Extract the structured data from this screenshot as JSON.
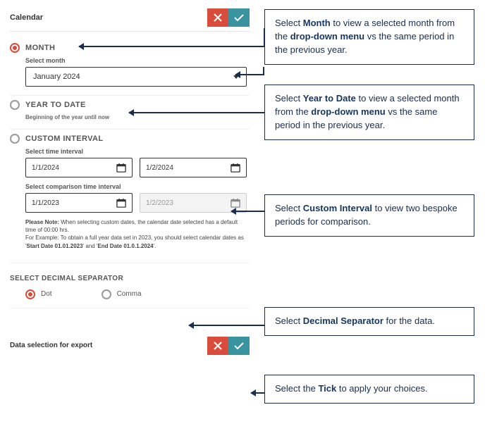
{
  "header": {
    "title": "Calendar"
  },
  "month": {
    "label": "MONTH",
    "selectLabel": "Select month",
    "value": "January 2024"
  },
  "ytd": {
    "label": "YEAR TO DATE",
    "note": "Beginning of the year until now"
  },
  "custom": {
    "label": "CUSTOM INTERVAL",
    "intervalLabel": "Select time interval",
    "start": "1/1/2024",
    "end": "1/2/2024",
    "compLabel": "Select comparison time interval",
    "compStart": "1/1/2023",
    "compEnd": "1/2/2023",
    "noteLead": "Please Note:",
    "noteBody": " When selecting custom dates, the calendar date selected has a default time of 00:00 hrs.",
    "noteEx1": "For Example: To obtain a full year data set in 2023, you should select calendar dates as '",
    "noteEx2": "Start Date 01.01.2023",
    "noteEx3": "' and '",
    "noteEx4": "End Date 01.0.1.2024",
    "noteEx5": "'."
  },
  "separator": {
    "title": "SELECT DECIMAL SEPARATOR",
    "dot": "Dot",
    "comma": "Comma"
  },
  "footer": {
    "title": "Data selection for export"
  },
  "callouts": {
    "c1a": "Select ",
    "c1b": "Month",
    "c1c": " to view a selected month from the ",
    "c1d": "drop-down menu",
    "c1e": " vs the same period in the previous year.",
    "c2a": "Select ",
    "c2b": "Year to Date",
    "c2c": " to view a selected month from the ",
    "c2d": "drop-down menu",
    "c2e": " vs the same period in the previous year.",
    "c3a": "Select ",
    "c3b": "Custom Interval",
    "c3c": " to view two bespoke periods for comparison.",
    "c4a": "Select ",
    "c4b": "Decimal Separator",
    "c4c": " for the data.",
    "c5a": "Select the ",
    "c5b": "Tick",
    "c5c": " to apply your choices."
  }
}
